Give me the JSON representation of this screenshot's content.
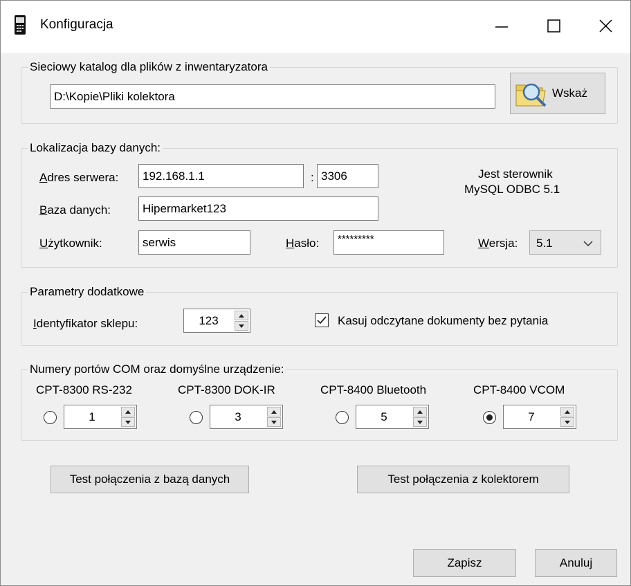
{
  "window": {
    "title": "Konfiguracja",
    "icon": "handheld-terminal-icon"
  },
  "network": {
    "legend": "Sieciowy katalog dla plików z inwentaryzatora",
    "path_value": "D:\\Kopie\\Pliki kolektora",
    "browse_label": "Wskaż",
    "browse_icon": "folder-search-icon"
  },
  "db": {
    "legend": "Lokalizacja bazy danych:",
    "server_label_first": "A",
    "server_label_rest": "dres serwera:",
    "server_value": "192.168.1.1",
    "port_sep": ":",
    "port_value": "3306",
    "driver_line1": "Jest sterownik",
    "driver_line2": "MySQL ODBC 5.1",
    "database_label_first": "B",
    "database_label_rest": "aza danych:",
    "database_value": "Hipermarket123",
    "user_label_first": "U",
    "user_label_rest": "żytkownik:",
    "user_value": "serwis",
    "password_label_first": "H",
    "password_label_rest": "asło:",
    "password_value": "*********",
    "version_label_first": "W",
    "version_label_rest": "ersja:",
    "version_value": "5.1"
  },
  "params": {
    "legend": "Parametry dodatkowe",
    "shop_label_first": "I",
    "shop_label_rest": "dentyfikator sklepu:",
    "shop_value": "123",
    "delete_label": "Kasuj odczytane dokumenty bez pytania",
    "delete_checked": true
  },
  "ports": {
    "legend": "Numery portów COM oraz domyślne urządzenie:",
    "items": [
      {
        "label": "CPT-8300 RS-232",
        "value": "1",
        "selected": false
      },
      {
        "label": "CPT-8300 DOK-IR",
        "value": "3",
        "selected": false
      },
      {
        "label": "CPT-8400 Bluetooth",
        "value": "5",
        "selected": false
      },
      {
        "label": "CPT-8400 VCOM",
        "value": "7",
        "selected": true
      }
    ]
  },
  "actions": {
    "test_db": "Test połączenia z bazą danych",
    "test_collector": "Test połączenia z kolektorem",
    "save": "Zapisz",
    "cancel": "Anuluj"
  }
}
